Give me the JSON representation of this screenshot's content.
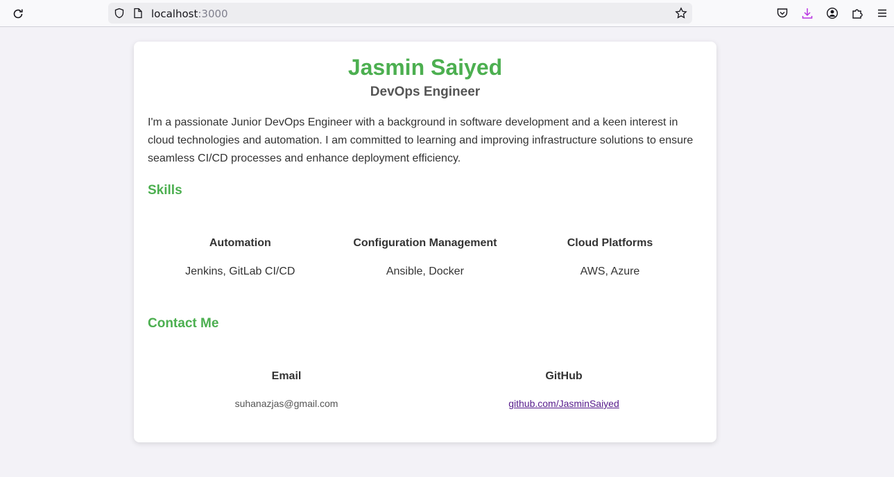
{
  "browser": {
    "url_host": "localhost",
    "url_port": ":3000"
  },
  "profile": {
    "name": "Jasmin Saiyed",
    "title": "DevOps Engineer",
    "bio": "I'm a passionate Junior DevOps Engineer with a background in software development and a keen interest in cloud technologies and automation. I am committed to learning and improving infrastructure solutions to ensure seamless CI/CD processes and enhance deployment efficiency."
  },
  "skills": {
    "heading": "Skills",
    "items": [
      {
        "label": "Automation",
        "value": "Jenkins, GitLab CI/CD"
      },
      {
        "label": "Configuration Management",
        "value": "Ansible, Docker"
      },
      {
        "label": "Cloud Platforms",
        "value": "AWS, Azure"
      }
    ]
  },
  "contact": {
    "heading": "Contact Me",
    "email_label": "Email",
    "email_value": "suhanazjas@gmail.com",
    "github_label": "GitHub",
    "github_value": "github.com/JasminSaiyed"
  },
  "colors": {
    "accent": "#4caf50",
    "background": "#f3f2f7"
  }
}
